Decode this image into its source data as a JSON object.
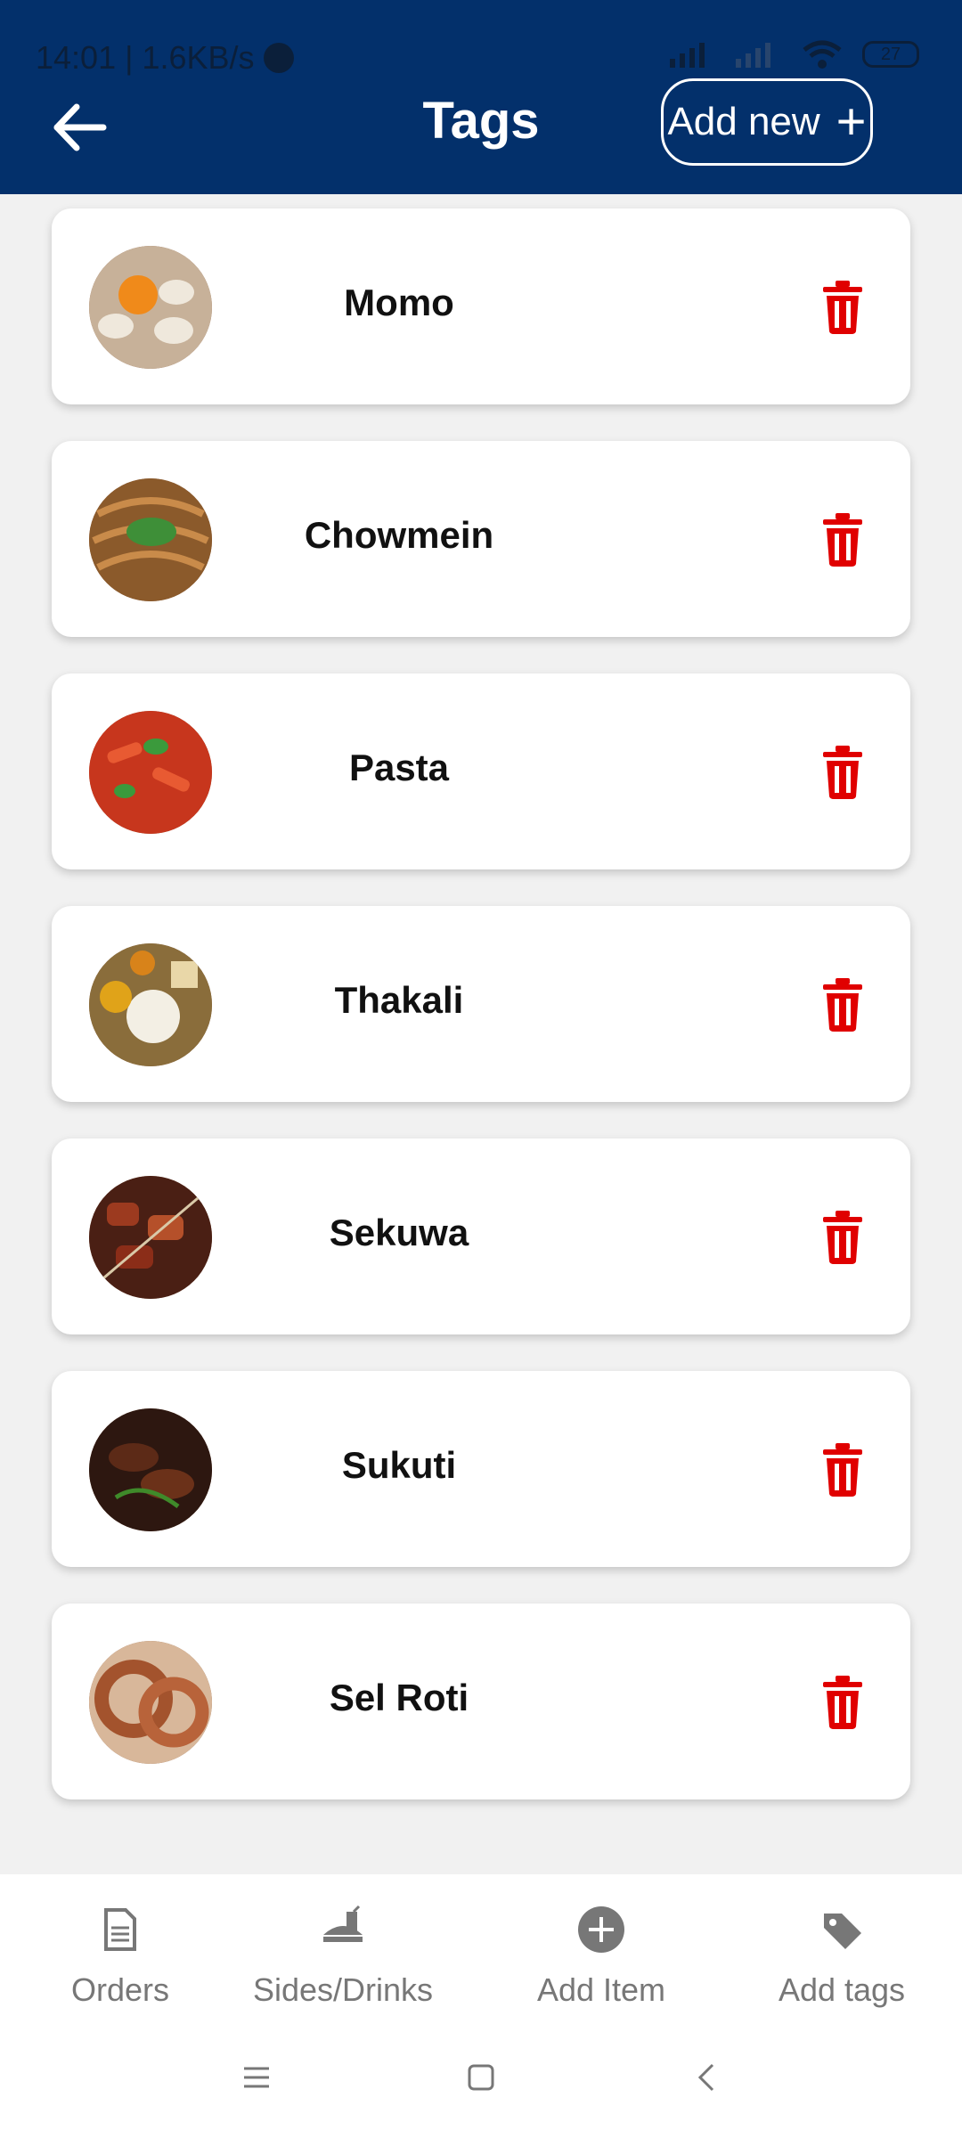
{
  "status_bar": {
    "time_speed": "14:01 | 1.6KB/s",
    "battery": "27"
  },
  "header": {
    "title": "Tags",
    "add_new_label": "Add new"
  },
  "tags": [
    {
      "name": "Momo",
      "image": "momo dumplings with dipping sauce"
    },
    {
      "name": "Chowmein",
      "image": "noodles stir fry"
    },
    {
      "name": "Pasta",
      "image": "penne pasta with herbs"
    },
    {
      "name": "Thakali",
      "image": "thakali thali meal"
    },
    {
      "name": "Sekuwa",
      "image": "grilled meat skewers"
    },
    {
      "name": "Sukuti",
      "image": "dried meat fry"
    },
    {
      "name": "Sel Roti",
      "image": "sel roti rings"
    }
  ],
  "bottom_nav": {
    "items": [
      {
        "label": "Orders",
        "icon": "document-icon"
      },
      {
        "label": "Sides/Drinks",
        "icon": "food-drink-icon"
      },
      {
        "label": "Add Item",
        "icon": "plus-circle-icon"
      },
      {
        "label": "Add tags",
        "icon": "tag-icon"
      }
    ]
  },
  "colors": {
    "header_bg": "#03306b",
    "trash": "#e00000",
    "nav_text": "#777777"
  }
}
